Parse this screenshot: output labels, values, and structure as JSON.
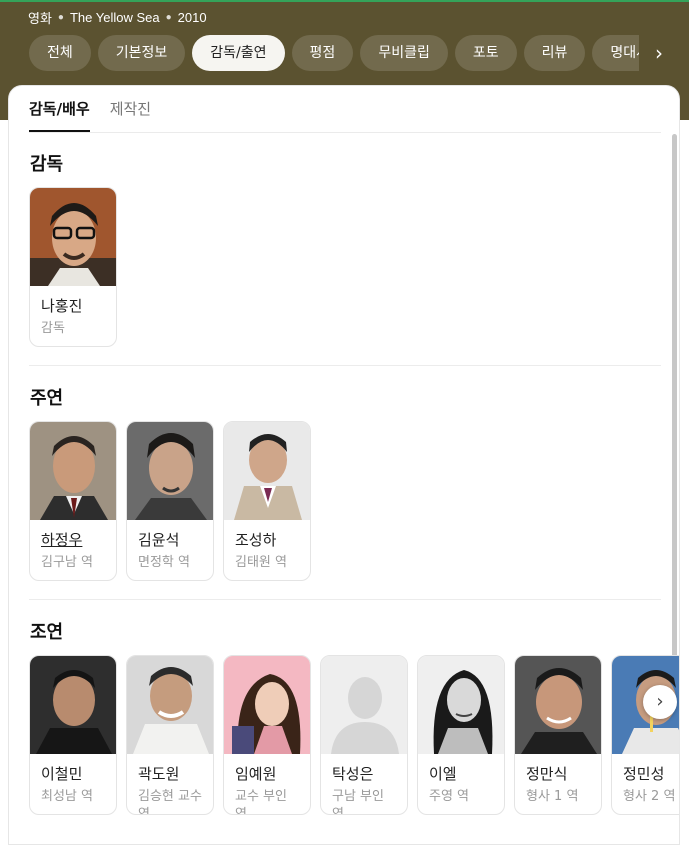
{
  "breadcrumb": {
    "category": "영화",
    "title": "The Yellow Sea",
    "year": "2010"
  },
  "tabs": [
    {
      "label": "전체"
    },
    {
      "label": "기본정보"
    },
    {
      "label": "감독/출연"
    },
    {
      "label": "평점"
    },
    {
      "label": "무비클립"
    },
    {
      "label": "포토"
    },
    {
      "label": "리뷰"
    },
    {
      "label": "명대사"
    }
  ],
  "active_tab": "감독/출연",
  "subtabs": [
    {
      "label": "감독/배우"
    },
    {
      "label": "제작진"
    }
  ],
  "sections": {
    "director": {
      "title": "감독",
      "people": [
        {
          "name": "나홍진",
          "role": "감독"
        }
      ]
    },
    "lead": {
      "title": "주연",
      "people": [
        {
          "name": "하정우",
          "role": "김구남 역"
        },
        {
          "name": "김윤석",
          "role": "면정학 역"
        },
        {
          "name": "조성하",
          "role": "김태원 역"
        }
      ]
    },
    "support": {
      "title": "조연",
      "people": [
        {
          "name": "이철민",
          "role": "최성남 역"
        },
        {
          "name": "곽도원",
          "role": "김승현 교수 역"
        },
        {
          "name": "임예원",
          "role": "교수 부인 역"
        },
        {
          "name": "탁성은",
          "role": "구남 부인 역"
        },
        {
          "name": "이엘",
          "role": "주영 역"
        },
        {
          "name": "정만식",
          "role": "형사 1 역"
        },
        {
          "name": "정민성",
          "role": "형사 2 역"
        }
      ]
    }
  },
  "icons": {
    "tabs_next": "chevron-right-icon",
    "carousel_next": "chevron-right-icon",
    "placeholder": "person-silhouette-icon"
  },
  "colors": {
    "header_bg": "#5b5230",
    "accent_line": "#35a35a"
  }
}
